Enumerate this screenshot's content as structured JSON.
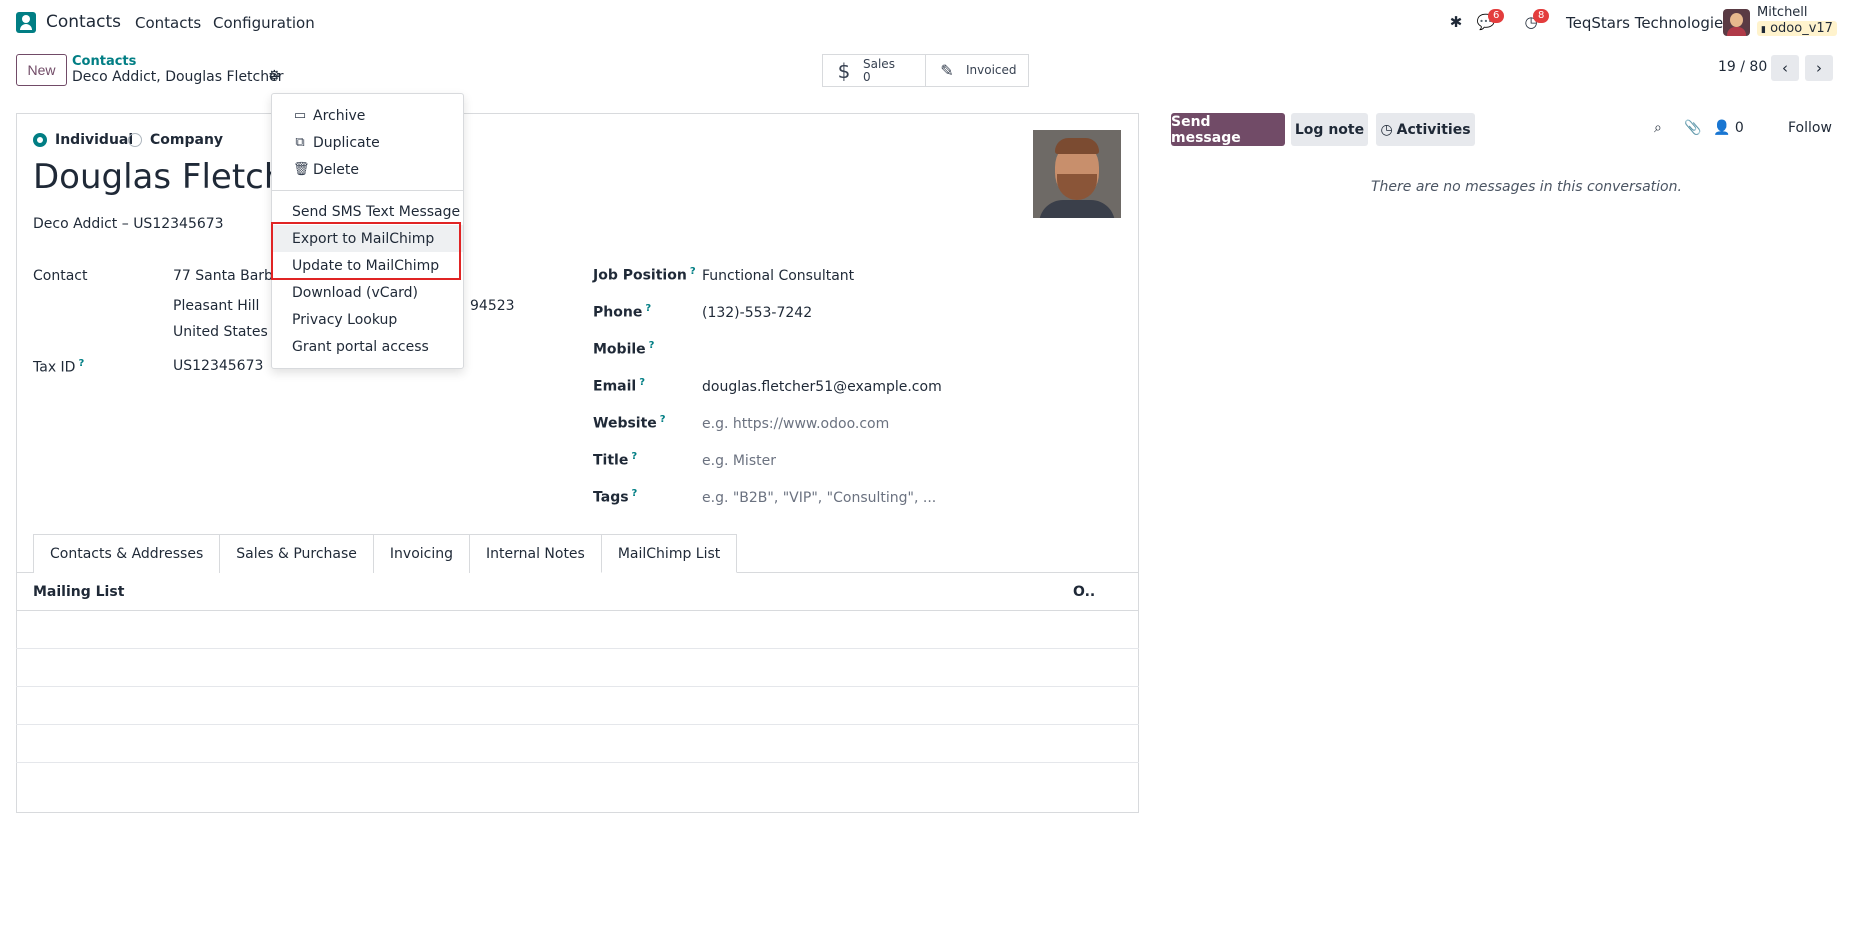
{
  "navbar": {
    "app_name": "Contacts",
    "menus": [
      "Contacts",
      "Configuration"
    ],
    "messages_count": "6",
    "activities_count": "8",
    "company": "TeqStars Technologies",
    "user_name": "Mitchell",
    "database": "odoo_v17"
  },
  "control_panel": {
    "new_label": "New",
    "breadcrumb_parent": "Contacts",
    "breadcrumb_current": "Deco Addict, Douglas Fletcher",
    "smart_sales_label": "Sales",
    "smart_sales_value": "0",
    "smart_invoiced_label": "Invoiced",
    "pager": "19 / 80"
  },
  "action_menu": {
    "items": [
      {
        "label": "Archive",
        "icon": "archive-icon"
      },
      {
        "label": "Duplicate",
        "icon": "copy-icon"
      },
      {
        "label": "Delete",
        "icon": "trash-icon"
      },
      {
        "label": "Send SMS Text Message"
      },
      {
        "label": "Export to MailChimp"
      },
      {
        "label": "Update to MailChimp"
      },
      {
        "label": "Download (vCard)"
      },
      {
        "label": "Privacy Lookup"
      },
      {
        "label": "Grant portal access"
      }
    ]
  },
  "form": {
    "type_individual": "Individual",
    "type_company": "Company",
    "name": "Douglas Fletcher",
    "subtitle": "Deco Addict – US12345673",
    "contact_label": "Contact",
    "address_street": "77 Santa Barbara Rd",
    "address_city": "Pleasant Hill",
    "address_zip": "94523",
    "address_country": "United States",
    "tax_id_label": "Tax ID",
    "tax_id_value": "US12345673",
    "job_position_label": "Job Position",
    "job_position_value": "Functional Consultant",
    "phone_label": "Phone",
    "phone_value": "(132)-553-7242",
    "mobile_label": "Mobile",
    "email_label": "Email",
    "email_value": "douglas.fletcher51@example.com",
    "website_label": "Website",
    "website_placeholder": "e.g. https://www.odoo.com",
    "title_label": "Title",
    "title_placeholder": "e.g. Mister",
    "tags_label": "Tags",
    "tags_placeholder": "e.g. \"B2B\", \"VIP\", \"Consulting\", ...",
    "help_mark": "?"
  },
  "tabs": [
    "Contacts & Addresses",
    "Sales & Purchase",
    "Invoicing",
    "Internal Notes",
    "MailChimp List"
  ],
  "mailing_list": {
    "col_mailing_list": "Mailing List",
    "col_opt": "O.."
  },
  "chatter": {
    "send_message": "Send message",
    "log_note": "Log note",
    "activities": "Activities",
    "followers_count": "0",
    "follow": "Follow",
    "empty_text": "There are no messages in this conversation."
  },
  "colors": {
    "brand": "#714b67",
    "accent": "#017e84",
    "highlight": "#e02424"
  }
}
